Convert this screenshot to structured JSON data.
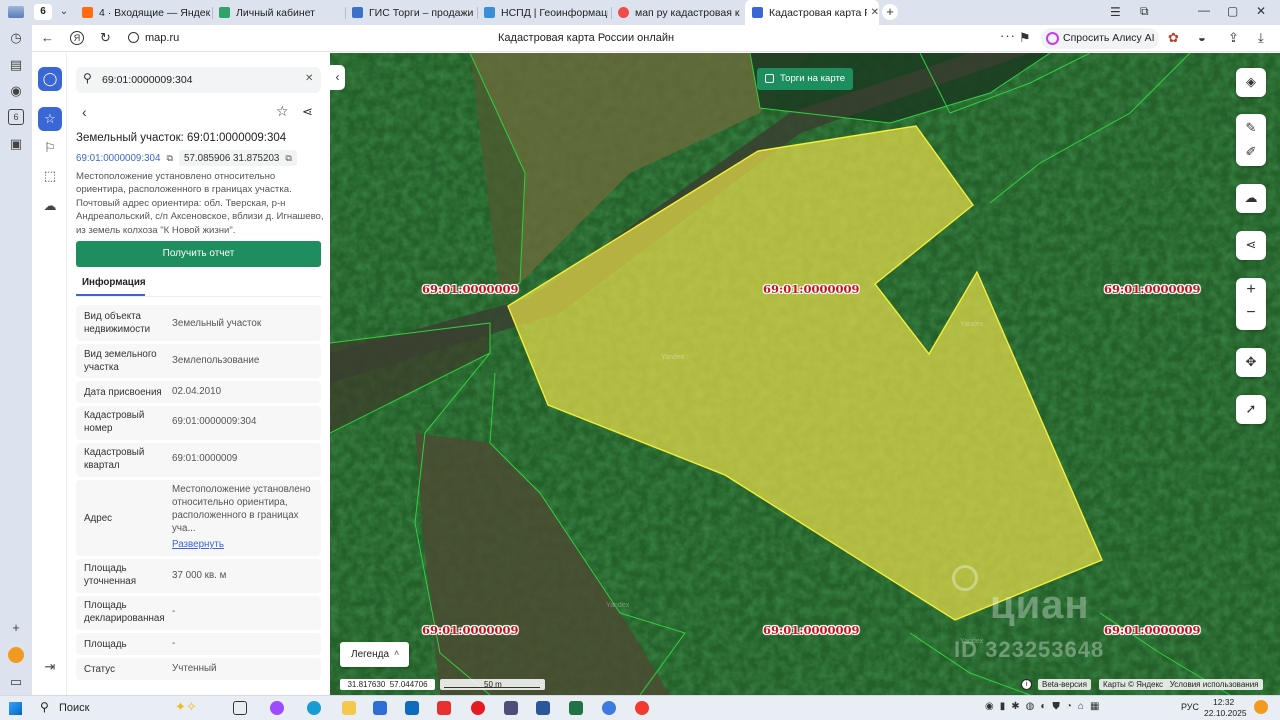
{
  "browser": {
    "tab_count": "6",
    "tabs": [
      {
        "label": "4 · Входящие — Яндекс П",
        "color": "#ff6a13"
      },
      {
        "label": "Личный кабинет",
        "color": "#2fa36b"
      },
      {
        "label": "ГИС Торги – продажи гос",
        "color": "#3f70c9"
      },
      {
        "label": "НСПД | Геоинформацио",
        "color": "#3b8fd9"
      },
      {
        "label": "мап ру кадастровая карт",
        "color": "#f24b4b"
      },
      {
        "label": "Кадастровая карта Рос",
        "color": "#3a66d6"
      }
    ],
    "url": "map.ru",
    "page_title": "Кадастровая карта России онлайн",
    "alice_label": "Спросить Алису AI"
  },
  "panel": {
    "search_value": "69:01:0000009:304",
    "title": "Земельный участок: 69:01:0000009:304",
    "cad_chip": "69:01:0000009:304",
    "coords_chip": "57.085906 31.875203",
    "description": "Местоположение установлено относительно ориентира, расположенного в границах участка. Почтовый адрес ориентира: обл. Тверская, р-н Андреапольский, с/п Аксеновское, вблизи д. Игнашево, из земель колхоза \"К Новой жизни\".",
    "report_button": "Получить отчет",
    "info_tab": "Информация",
    "rows": [
      {
        "key": "Вид объекта недвижимости",
        "value": "Земельный участок"
      },
      {
        "key": "Вид земельного участка",
        "value": "Землепользование"
      },
      {
        "key": "Дата присвоения",
        "value": "02.04.2010"
      },
      {
        "key": "Кадастровый номер",
        "value": "69:01:0000009:304"
      },
      {
        "key": "Кадастровый квартал",
        "value": "69:01:0000009"
      },
      {
        "key": "Адрес",
        "value": "Местоположение установлено относительно ориентира, расположенного в границах уча...",
        "link": "Развернуть"
      },
      {
        "key": "Площадь уточненная",
        "value": "37 000 кв. м"
      },
      {
        "key": "Площадь декларированная",
        "value": "-"
      },
      {
        "key": "Площадь",
        "value": "-"
      },
      {
        "key": "Статус",
        "value": "Учтенный"
      }
    ]
  },
  "map": {
    "torgi_label": "Торги на карте",
    "legend_label": "Легенда",
    "quarter_label": "69:01:0000009",
    "yandex_mark": "Yandex",
    "watermark_brand": "циан",
    "watermark_id": "ID 323253648",
    "coords_readout": "31.817630  57.044706",
    "scale_label": "50 m",
    "beta_label": "Beta-версия",
    "attribution": "Карты © Яндекс   Условия использования",
    "parcel_color": "#e6dc4a",
    "highlight_color": "#f4ef3a",
    "brand_color": "#1e8e5e"
  },
  "taskbar": {
    "search_label": "Поиск",
    "lang": "РУС",
    "time": "12:32",
    "date": "22.10.2025"
  }
}
